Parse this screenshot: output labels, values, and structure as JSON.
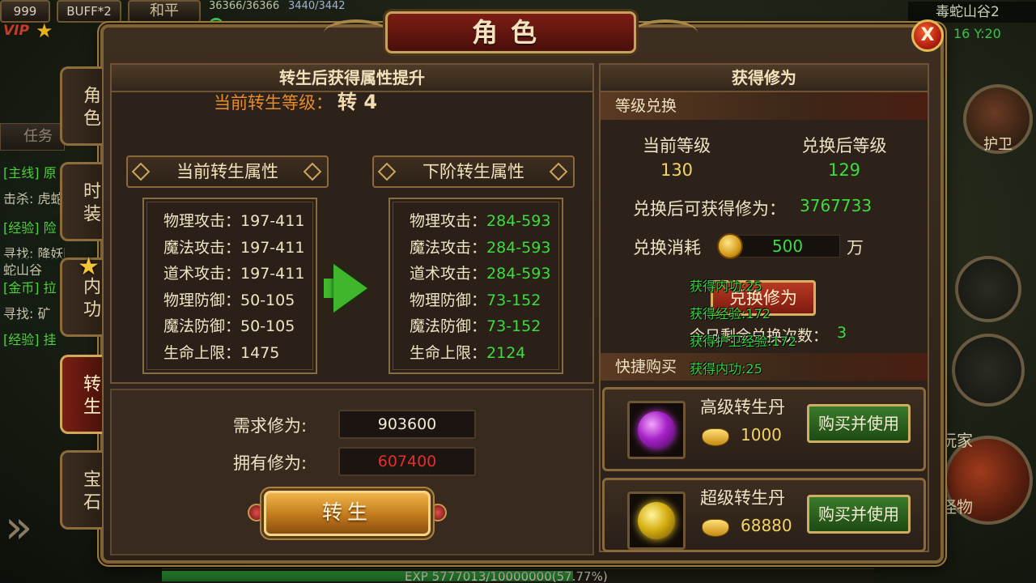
{
  "hud": {
    "level": "999",
    "buff": "BUFF*2",
    "pk_mode": "和平",
    "hp": "36366/36366",
    "mp": "3440/3442",
    "vip": "VIP",
    "map_name": "毒蛇山谷2",
    "coords": "16  Y:20",
    "quest_tab": "任务",
    "quest_lines": [
      "[主线] 原",
      "击杀: 虎蛇",
      "[经验] 险",
      "寻找: 降妖降",
      "蛇山谷",
      "[金币] 拉",
      "寻找: 矿",
      "[经验] 挂"
    ],
    "right_buttons": {
      "guard": "护卫",
      "player": "玩家",
      "monster": "怪物"
    },
    "exp_text": "EXP  5777013/10000000(57.77%)",
    "exp_percent": 57.77
  },
  "panel": {
    "title": "角色",
    "close_label": "X",
    "tabs": [
      {
        "label": "角色",
        "active": false
      },
      {
        "label": "时装",
        "active": false
      },
      {
        "label": "内功",
        "active": false
      },
      {
        "label": "转生",
        "active": true
      },
      {
        "label": "宝石",
        "active": false
      }
    ]
  },
  "rebirth": {
    "header": "转生后获得属性提升",
    "current_level_label": "当前转生等级：",
    "current_level_value": "转 4",
    "current_title": "当前转生属性",
    "next_title": "下阶转生属性",
    "current_stats": [
      {
        "label": "物理攻击：",
        "value": "197-411"
      },
      {
        "label": "魔法攻击：",
        "value": "197-411"
      },
      {
        "label": "道术攻击：",
        "value": "197-411"
      },
      {
        "label": "物理防御：",
        "value": "50-105"
      },
      {
        "label": "魔法防御：",
        "value": "50-105"
      },
      {
        "label": "生命上限：",
        "value": "1475"
      }
    ],
    "next_stats": [
      {
        "label": "物理攻击：",
        "value": "284-593"
      },
      {
        "label": "魔法攻击：",
        "value": "284-593"
      },
      {
        "label": "道术攻击：",
        "value": "284-593"
      },
      {
        "label": "物理防御：",
        "value": "73-152"
      },
      {
        "label": "魔法防御：",
        "value": "73-152"
      },
      {
        "label": "生命上限：",
        "value": "2124"
      }
    ],
    "required_label": "需求修为:",
    "required_value": "903600",
    "owned_label": "拥有修为:",
    "owned_value": "607400",
    "button_label": "转生"
  },
  "cultivation": {
    "header": "获得修为",
    "exchange_head": "等级兑换",
    "current_level_label": "当前等级",
    "current_level_value": "130",
    "after_level_label": "兑换后等级",
    "after_level_value": "129",
    "gain_label": "兑换后可获得修为：",
    "gain_value": "3767733",
    "cost_label": "兑换消耗",
    "cost_value": "500",
    "cost_unit": "万",
    "exchange_button": "兑换修为",
    "remaining_label": "今日剩余兑换次数：",
    "remaining_value": "3",
    "float_messages": [
      "获得内功:25",
      "获得经验:172",
      "获得护卫经验:172",
      "获得内功:25"
    ],
    "quick_buy_head": "快捷购买",
    "items": [
      {
        "name": "高级转生丹",
        "price": "1000",
        "button": "购买并使用",
        "icon": "purple-orb-icon"
      },
      {
        "name": "超级转生丹",
        "price": "68880",
        "button": "购买并使用",
        "icon": "gold-orb-icon"
      }
    ]
  },
  "colors": {
    "accent_gold": "#c5a25c",
    "title_red": "#7c1d14",
    "stat_green": "#3bdc3e",
    "owned_red": "#e2302a",
    "level_orange": "#e58b2c"
  }
}
